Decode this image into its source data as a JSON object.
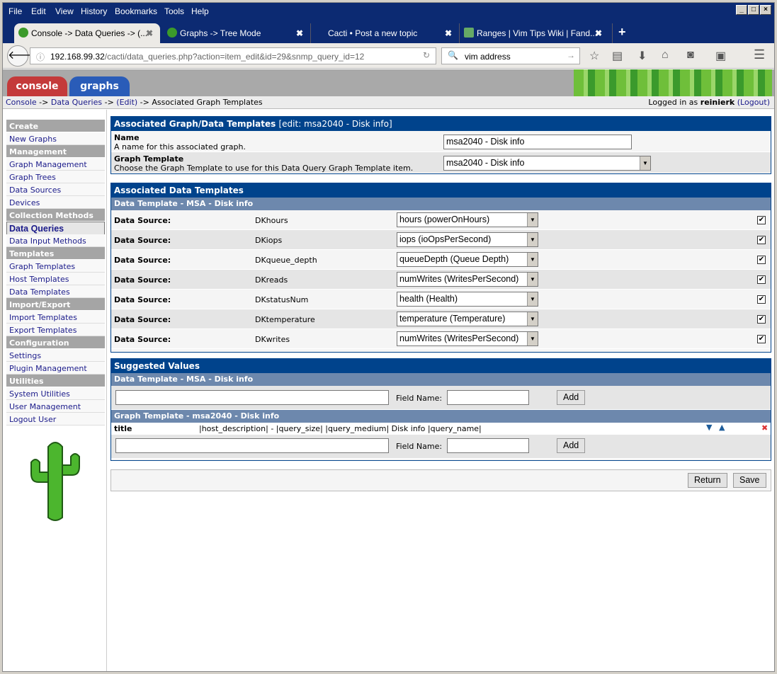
{
  "browser": {
    "menu": [
      "File",
      "Edit",
      "View",
      "History",
      "Bookmarks",
      "Tools",
      "Help"
    ],
    "tabs": [
      {
        "label": "Console -> Data Queries -> (...",
        "active": true
      },
      {
        "label": "Graphs -> Tree Mode"
      },
      {
        "label": "Cacti • Post a new topic"
      },
      {
        "label": "Ranges | Vim Tips Wiki | Fand..."
      }
    ],
    "url_host": "192.168.99.32",
    "url_path": "/cacti/data_queries.php?action=item_edit&id=29&snmp_query_id=12",
    "search_value": "vim address"
  },
  "header": {
    "tab_console": "console",
    "tab_graphs": "graphs"
  },
  "breadcrumb": {
    "console": "Console",
    "sep": " -> ",
    "data_queries": "Data Queries",
    "edit": "(Edit)",
    "current": "Associated Graph Templates"
  },
  "login": {
    "prefix": "Logged in as ",
    "user": "reinierk",
    "logout": "(Logout)"
  },
  "sidebar": [
    {
      "label": "Create",
      "type": "header"
    },
    {
      "label": "New Graphs"
    },
    {
      "label": "Management",
      "type": "header"
    },
    {
      "label": "Graph Management"
    },
    {
      "label": "Graph Trees"
    },
    {
      "label": "Data Sources"
    },
    {
      "label": "Devices"
    },
    {
      "label": "Collection Methods",
      "type": "header"
    },
    {
      "label": "Data Queries",
      "selected": true
    },
    {
      "label": "Data Input Methods"
    },
    {
      "label": "Templates",
      "type": "header"
    },
    {
      "label": "Graph Templates"
    },
    {
      "label": "Host Templates"
    },
    {
      "label": "Data Templates"
    },
    {
      "label": "Import/Export",
      "type": "header"
    },
    {
      "label": "Import Templates"
    },
    {
      "label": "Export Templates"
    },
    {
      "label": "Configuration",
      "type": "header"
    },
    {
      "label": "Settings"
    },
    {
      "label": "Plugin Management"
    },
    {
      "label": "Utilities",
      "type": "header"
    },
    {
      "label": "System Utilities"
    },
    {
      "label": "User Management"
    },
    {
      "label": "Logout User"
    }
  ],
  "assoc": {
    "title": "Associated Graph/Data Templates",
    "edit": "[edit: msa2040 - Disk info]",
    "name_label": "Name",
    "name_desc": "A name for this associated graph.",
    "name_value": "msa2040 - Disk info",
    "gt_label": "Graph Template",
    "gt_desc": "Choose the Graph Template to use for this Data Query Graph Template item.",
    "gt_value": "msa2040 - Disk info"
  },
  "data_templates": {
    "title": "Associated Data Templates",
    "subheader": "Data Template - MSA - Disk info",
    "label": "Data Source:",
    "rows": [
      {
        "name": "DKhours",
        "value": "hours (powerOnHours)",
        "checked": true
      },
      {
        "name": "DKiops",
        "value": "iops (ioOpsPerSecond)",
        "checked": true
      },
      {
        "name": "DKqueue_depth",
        "value": "queueDepth (Queue Depth)",
        "checked": true
      },
      {
        "name": "DKreads",
        "value": "numWrites (WritesPerSecond)",
        "checked": true
      },
      {
        "name": "DKstatusNum",
        "value": "health (Health)",
        "checked": true
      },
      {
        "name": "DKtemperature",
        "value": "temperature (Temperature)",
        "checked": true
      },
      {
        "name": "DKwrites",
        "value": "numWrites (WritesPerSecond)",
        "checked": true
      }
    ]
  },
  "suggested": {
    "title": "Suggested Values",
    "dt_header": "Data Template - MSA - Disk info",
    "gt_header": "Graph Template - msa2040 - Disk info",
    "field_name_label": "Field Name:",
    "add": "Add",
    "gt_item": {
      "field": "title",
      "value": "|host_description| - |query_size| |query_medium| Disk info |query_name|"
    }
  },
  "actions": {
    "return": "Return",
    "save": "Save"
  },
  "colors": {
    "header_blue": "#00438c",
    "subheader": "#6d88ad",
    "browser_chrome": "#0c2a72"
  }
}
